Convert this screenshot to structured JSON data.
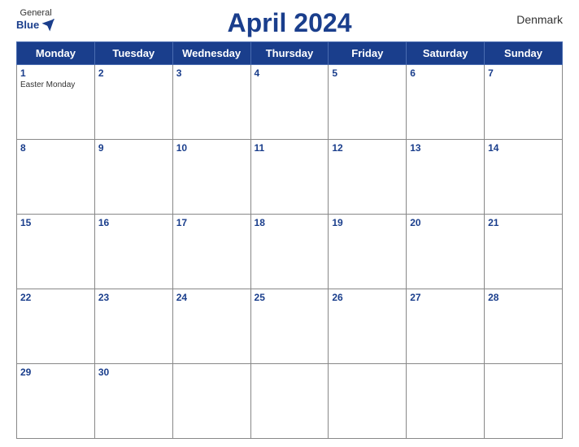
{
  "header": {
    "logo_general": "General",
    "logo_blue": "Blue",
    "title": "April 2024",
    "country": "Denmark"
  },
  "days_of_week": [
    "Monday",
    "Tuesday",
    "Wednesday",
    "Thursday",
    "Friday",
    "Saturday",
    "Sunday"
  ],
  "weeks": [
    [
      {
        "day": "1",
        "event": "Easter Monday"
      },
      {
        "day": "2",
        "event": ""
      },
      {
        "day": "3",
        "event": ""
      },
      {
        "day": "4",
        "event": ""
      },
      {
        "day": "5",
        "event": ""
      },
      {
        "day": "6",
        "event": ""
      },
      {
        "day": "7",
        "event": ""
      }
    ],
    [
      {
        "day": "8",
        "event": ""
      },
      {
        "day": "9",
        "event": ""
      },
      {
        "day": "10",
        "event": ""
      },
      {
        "day": "11",
        "event": ""
      },
      {
        "day": "12",
        "event": ""
      },
      {
        "day": "13",
        "event": ""
      },
      {
        "day": "14",
        "event": ""
      }
    ],
    [
      {
        "day": "15",
        "event": ""
      },
      {
        "day": "16",
        "event": ""
      },
      {
        "day": "17",
        "event": ""
      },
      {
        "day": "18",
        "event": ""
      },
      {
        "day": "19",
        "event": ""
      },
      {
        "day": "20",
        "event": ""
      },
      {
        "day": "21",
        "event": ""
      }
    ],
    [
      {
        "day": "22",
        "event": ""
      },
      {
        "day": "23",
        "event": ""
      },
      {
        "day": "24",
        "event": ""
      },
      {
        "day": "25",
        "event": ""
      },
      {
        "day": "26",
        "event": ""
      },
      {
        "day": "27",
        "event": ""
      },
      {
        "day": "28",
        "event": ""
      }
    ],
    [
      {
        "day": "29",
        "event": ""
      },
      {
        "day": "30",
        "event": ""
      },
      {
        "day": "",
        "event": ""
      },
      {
        "day": "",
        "event": ""
      },
      {
        "day": "",
        "event": ""
      },
      {
        "day": "",
        "event": ""
      },
      {
        "day": "",
        "event": ""
      }
    ]
  ]
}
